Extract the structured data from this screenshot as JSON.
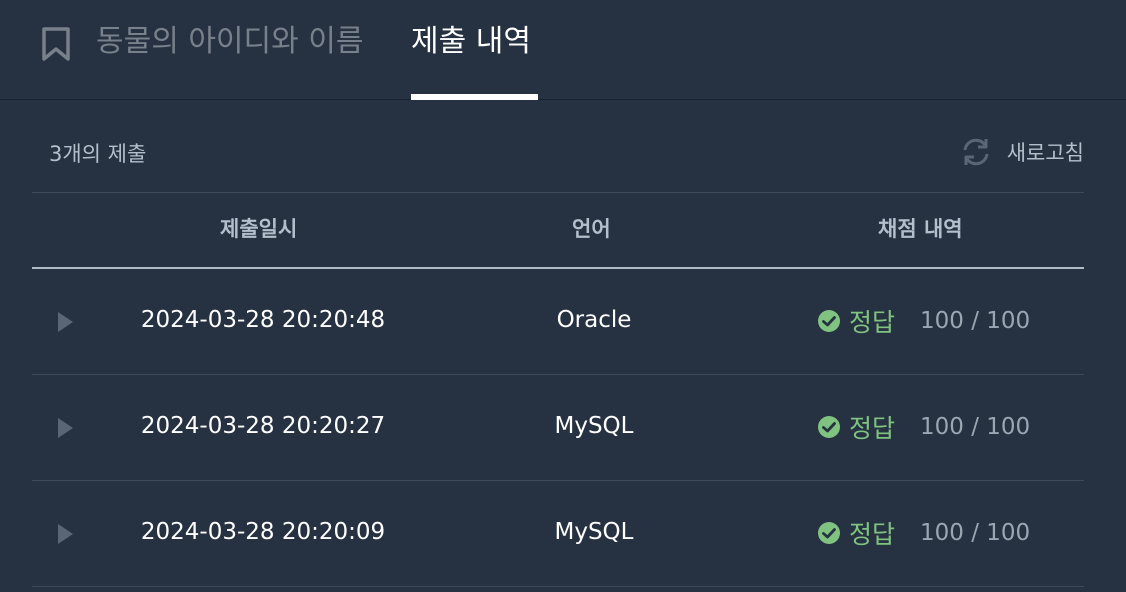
{
  "header": {
    "problem_title": "동물의 아이디와 이름",
    "active_tab": "제출 내역"
  },
  "summary": {
    "count_text": "3개의 제출",
    "refresh_label": "새로고침"
  },
  "table": {
    "columns": [
      "제출일시",
      "언어",
      "채점 내역"
    ],
    "rows": [
      {
        "datetime": "2024-03-28 20:20:48",
        "language": "Oracle",
        "result": "정답",
        "score": "100 / 100"
      },
      {
        "datetime": "2024-03-28 20:20:27",
        "language": "MySQL",
        "result": "정답",
        "score": "100 / 100"
      },
      {
        "datetime": "2024-03-28 20:20:09",
        "language": "MySQL",
        "result": "정답",
        "score": "100 / 100"
      }
    ]
  },
  "colors": {
    "background": "#263241",
    "success": "#80c280",
    "muted_text": "#b2c0cc"
  },
  "icons": {
    "bookmark": "bookmark-icon",
    "refresh": "refresh-icon",
    "expand": "play-triangle-icon",
    "success": "check-circle-icon"
  }
}
